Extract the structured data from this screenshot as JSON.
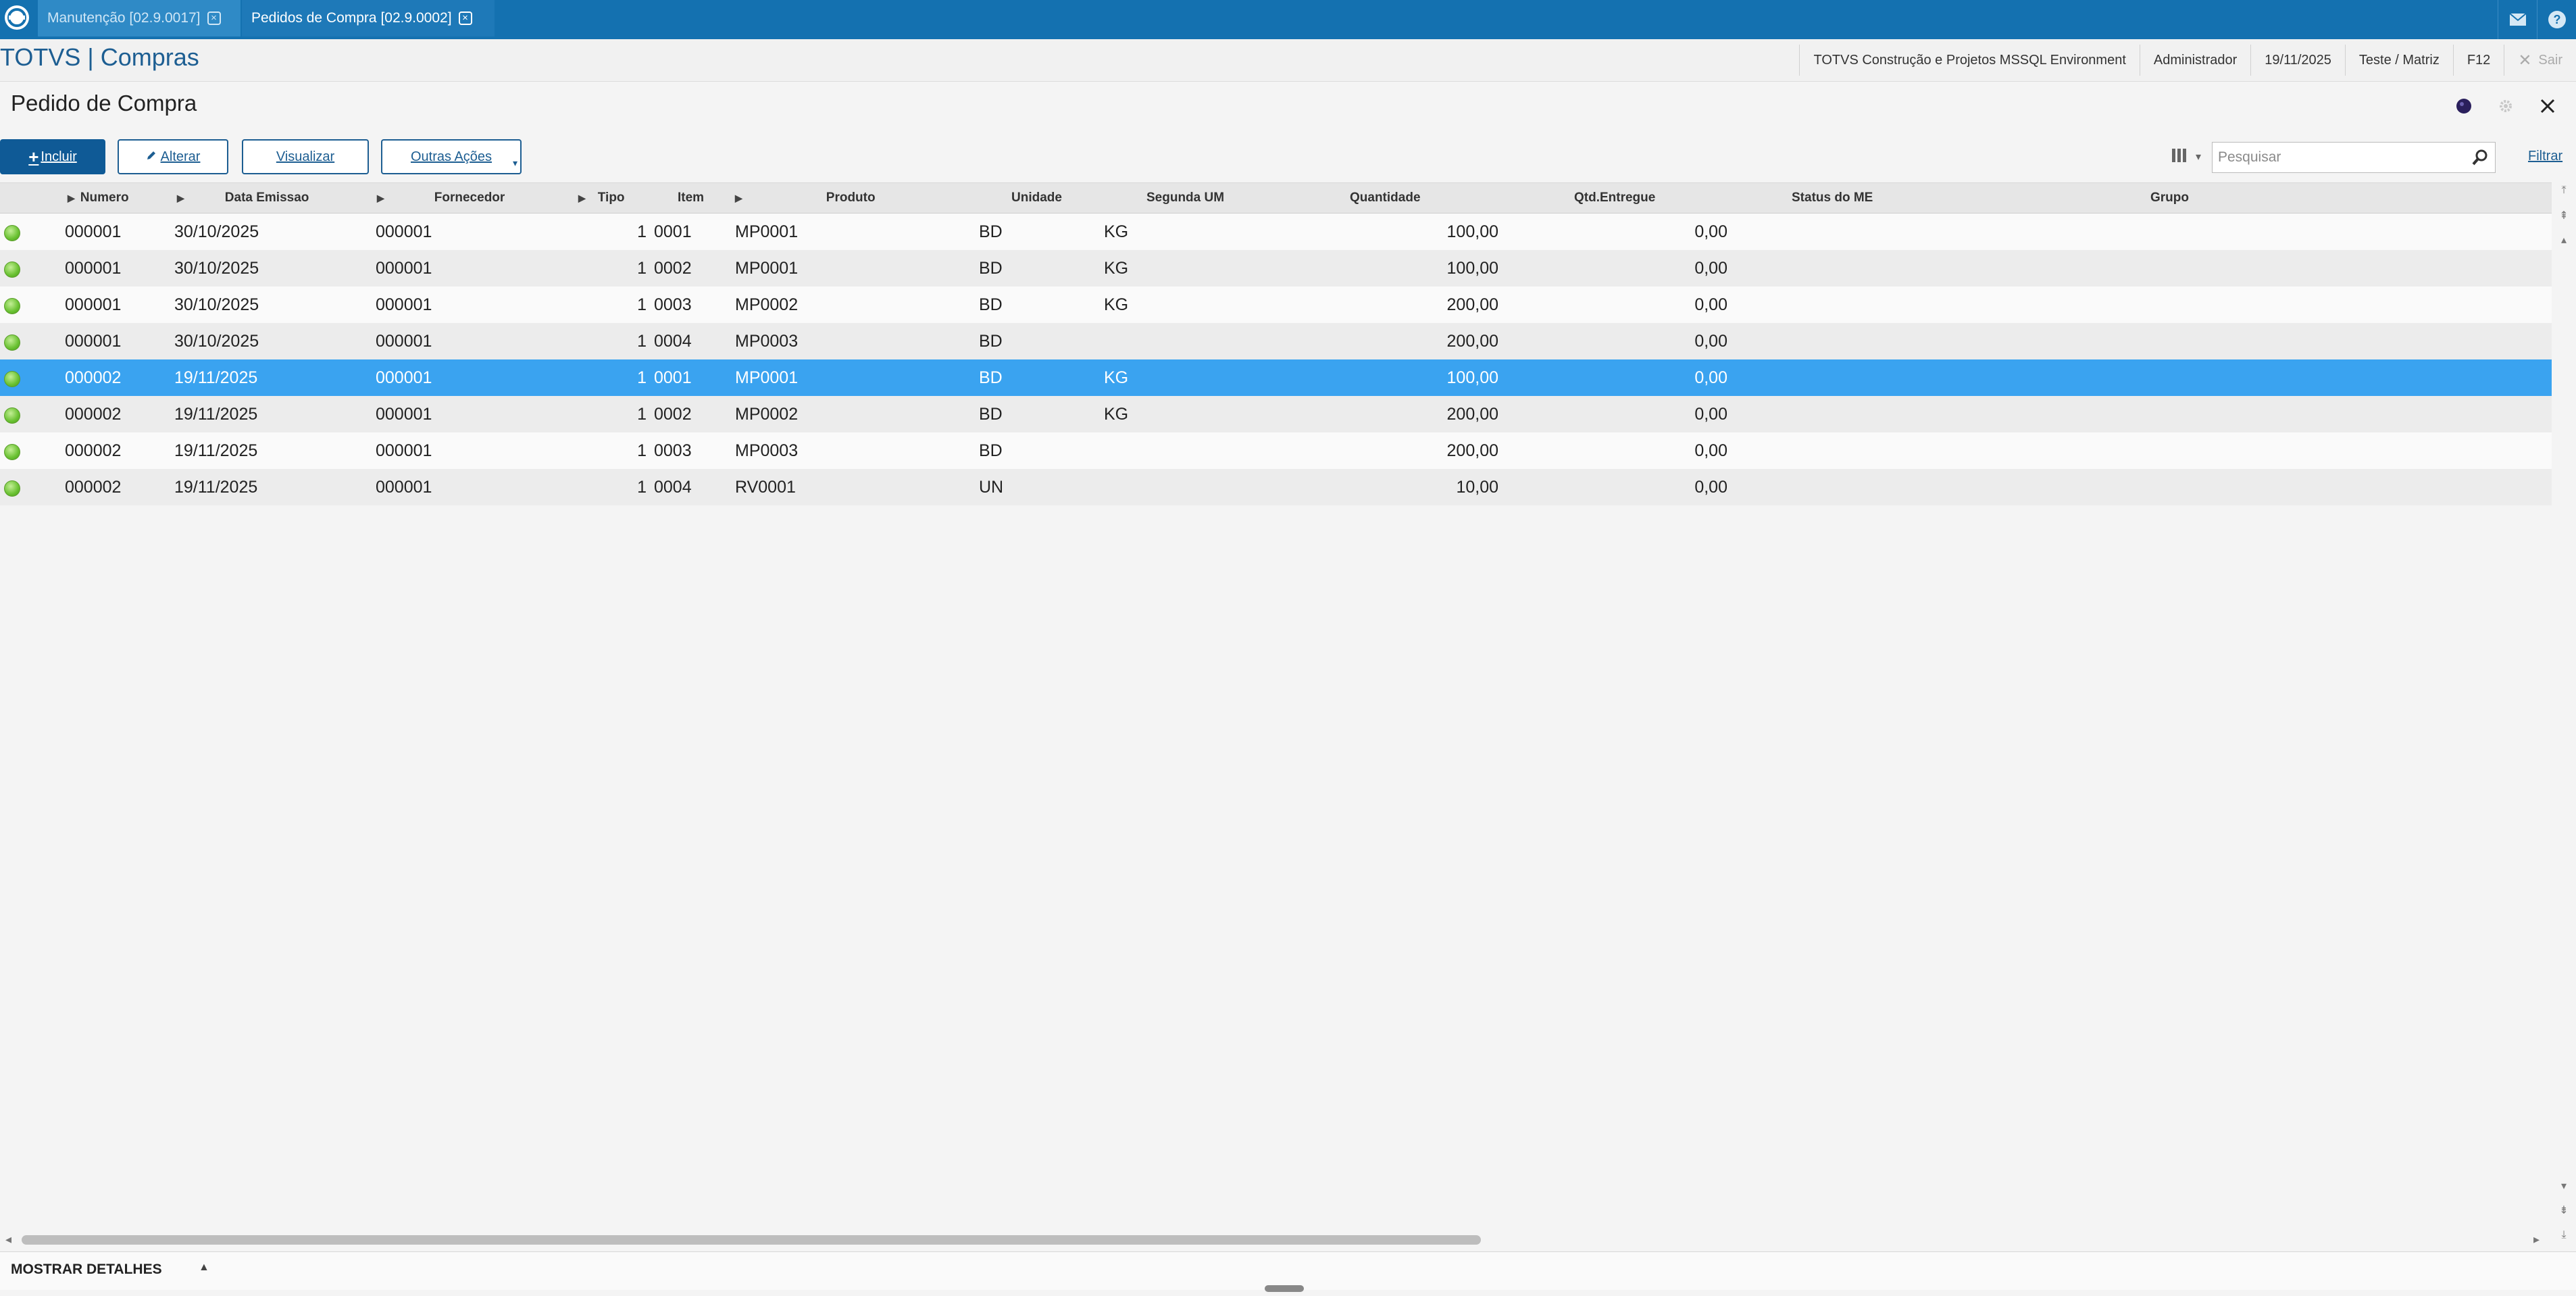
{
  "top_tabs": [
    {
      "label": "Manutenção [02.9.0017]"
    },
    {
      "label": "Pedidos de Compra [02.9.0002]"
    }
  ],
  "header": {
    "app_title": "TOTVS | Compras",
    "environment": "TOTVS Construção e Projetos MSSQL Environment",
    "user": "Administrador",
    "date": "19/11/2025",
    "branch": "Teste / Matriz",
    "f12": "F12",
    "exit_label": "Sair"
  },
  "page": {
    "title": "Pedido de Compra"
  },
  "toolbar": {
    "include_label": "Incluir",
    "edit_label": "Alterar",
    "view_label": "Visualizar",
    "more_label": "Outras Ações"
  },
  "search": {
    "placeholder": "Pesquisar",
    "filter_label": "Filtrar"
  },
  "grid": {
    "columns": {
      "numero": "Numero",
      "data": "Data Emissao",
      "fornecedor": "Fornecedor",
      "tipo": "Tipo",
      "item": "Item",
      "produto": "Produto",
      "unidade": "Unidade",
      "segunda_um": "Segunda UM",
      "quantidade": "Quantidade",
      "qtd_entregue": "Qtd.Entregue",
      "status_me": "Status do ME",
      "grupo": "Grupo"
    },
    "selected_row_index": 4,
    "status_color": "#69c131",
    "selection_color": "#3aa3f0",
    "rows": [
      {
        "numero": "000001",
        "data": "30/10/2025",
        "fornecedor": "000001",
        "tipo": "1",
        "item": "0001",
        "produto": "MP0001",
        "unidade": "BD",
        "segunda_um": "KG",
        "quantidade": "100,00",
        "qtd_entregue": "0,00"
      },
      {
        "numero": "000001",
        "data": "30/10/2025",
        "fornecedor": "000001",
        "tipo": "1",
        "item": "0002",
        "produto": "MP0001",
        "unidade": "BD",
        "segunda_um": "KG",
        "quantidade": "100,00",
        "qtd_entregue": "0,00"
      },
      {
        "numero": "000001",
        "data": "30/10/2025",
        "fornecedor": "000001",
        "tipo": "1",
        "item": "0003",
        "produto": "MP0002",
        "unidade": "BD",
        "segunda_um": "KG",
        "quantidade": "200,00",
        "qtd_entregue": "0,00"
      },
      {
        "numero": "000001",
        "data": "30/10/2025",
        "fornecedor": "000001",
        "tipo": "1",
        "item": "0004",
        "produto": "MP0003",
        "unidade": "BD",
        "segunda_um": "",
        "quantidade": "200,00",
        "qtd_entregue": "0,00"
      },
      {
        "numero": "000002",
        "data": "19/11/2025",
        "fornecedor": "000001",
        "tipo": "1",
        "item": "0001",
        "produto": "MP0001",
        "unidade": "BD",
        "segunda_um": "KG",
        "quantidade": "100,00",
        "qtd_entregue": "0,00"
      },
      {
        "numero": "000002",
        "data": "19/11/2025",
        "fornecedor": "000001",
        "tipo": "1",
        "item": "0002",
        "produto": "MP0002",
        "unidade": "BD",
        "segunda_um": "KG",
        "quantidade": "200,00",
        "qtd_entregue": "0,00"
      },
      {
        "numero": "000002",
        "data": "19/11/2025",
        "fornecedor": "000001",
        "tipo": "1",
        "item": "0003",
        "produto": "MP0003",
        "unidade": "BD",
        "segunda_um": "",
        "quantidade": "200,00",
        "qtd_entregue": "0,00"
      },
      {
        "numero": "000002",
        "data": "19/11/2025",
        "fornecedor": "000001",
        "tipo": "1",
        "item": "0004",
        "produto": "RV0001",
        "unidade": "UN",
        "segunda_um": "",
        "quantidade": "10,00",
        "qtd_entregue": "0,00"
      }
    ]
  },
  "footer": {
    "details_label": "MOSTRAR DETALHES"
  },
  "icons": {
    "logo": "totvs-logo-icon",
    "tab_close": "close-icon",
    "mail": "mail-icon",
    "help": "help-icon",
    "exit": "close-icon",
    "search": "search-icon",
    "columns": "columns-icon",
    "settings": "gear-icon"
  }
}
